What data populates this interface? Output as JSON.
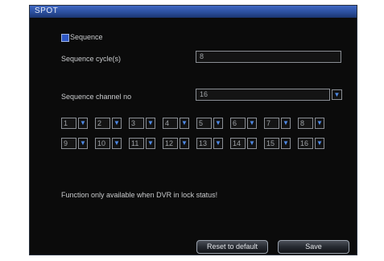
{
  "window": {
    "title": "SPOT"
  },
  "sequence": {
    "checkbox_label": "Sequence",
    "cycle_label": "Sequence cycle(s)",
    "cycle_value": "8",
    "channel_no_label": "Sequence channel no",
    "channel_no_value": "16",
    "channels": [
      "1",
      "2",
      "3",
      "4",
      "5",
      "6",
      "7",
      "8",
      "9",
      "10",
      "11",
      "12",
      "13",
      "14",
      "15",
      "16"
    ]
  },
  "note": "Function only available when DVR in lock status!",
  "buttons": {
    "reset": "Reset to default",
    "save": "Save"
  },
  "icons": {
    "dropdown": "chevron-down-icon"
  },
  "colors": {
    "accent": "#2e57c4",
    "title_bar": "#2b4f9e",
    "background": "#0b0b0b"
  }
}
